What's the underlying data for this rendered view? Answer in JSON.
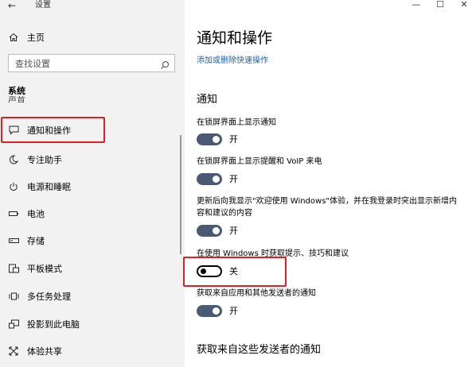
{
  "window": {
    "title": "设置",
    "minimize": "—",
    "maximize": "☐",
    "close": "✕"
  },
  "sidebar": {
    "home": "主页",
    "search_placeholder": "查找设置",
    "section": "系统",
    "partial_item": "声音",
    "items": [
      {
        "label": "通知和操作",
        "icon": "notification-icon"
      },
      {
        "label": "专注助手",
        "icon": "moon-icon"
      },
      {
        "label": "电源和睡眠",
        "icon": "power-icon"
      },
      {
        "label": "电池",
        "icon": "battery-icon"
      },
      {
        "label": "存储",
        "icon": "storage-icon"
      },
      {
        "label": "平板模式",
        "icon": "tablet-icon"
      },
      {
        "label": "多任务处理",
        "icon": "multitask-icon"
      },
      {
        "label": "投影到此电脑",
        "icon": "project-icon"
      },
      {
        "label": "体验共享",
        "icon": "share-icon"
      }
    ]
  },
  "main": {
    "title": "通知和操作",
    "quick_link": "添加或删除快速操作",
    "notifications_heading": "通知",
    "settings": [
      {
        "label": "在锁屏界面上显示通知",
        "state": "开",
        "on": true
      },
      {
        "label": "在锁屏界面上显示提醒和 VoIP 来电",
        "state": "开",
        "on": true
      },
      {
        "label": "更新后向我显示\"欢迎使用 Windows\"体验，并在我登录时突出显示新增内容和建议的内容",
        "state": "开",
        "on": true
      },
      {
        "label": "在使用 Windows 时获取提示、技巧和建议",
        "state": "关",
        "on": false
      },
      {
        "label": "获取来自应用和其他发送者的通知",
        "state": "开",
        "on": true
      }
    ],
    "senders_heading": "获取来自这些发送者的通知"
  },
  "colors": {
    "highlight": "#e02020",
    "toggle_on": "#4a5a74",
    "link": "#1b5fb3",
    "sidebar_bg": "#f2f2f2"
  }
}
